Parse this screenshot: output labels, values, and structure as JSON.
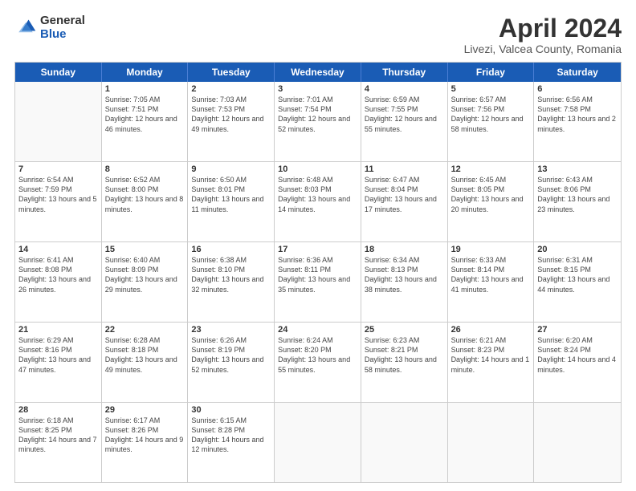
{
  "header": {
    "logo_general": "General",
    "logo_blue": "Blue",
    "title": "April 2024",
    "subtitle": "Livezi, Valcea County, Romania"
  },
  "weekdays": [
    "Sunday",
    "Monday",
    "Tuesday",
    "Wednesday",
    "Thursday",
    "Friday",
    "Saturday"
  ],
  "weeks": [
    [
      {
        "num": "",
        "sunrise": "",
        "sunset": "",
        "daylight": ""
      },
      {
        "num": "1",
        "sunrise": "Sunrise: 7:05 AM",
        "sunset": "Sunset: 7:51 PM",
        "daylight": "Daylight: 12 hours and 46 minutes."
      },
      {
        "num": "2",
        "sunrise": "Sunrise: 7:03 AM",
        "sunset": "Sunset: 7:53 PM",
        "daylight": "Daylight: 12 hours and 49 minutes."
      },
      {
        "num": "3",
        "sunrise": "Sunrise: 7:01 AM",
        "sunset": "Sunset: 7:54 PM",
        "daylight": "Daylight: 12 hours and 52 minutes."
      },
      {
        "num": "4",
        "sunrise": "Sunrise: 6:59 AM",
        "sunset": "Sunset: 7:55 PM",
        "daylight": "Daylight: 12 hours and 55 minutes."
      },
      {
        "num": "5",
        "sunrise": "Sunrise: 6:57 AM",
        "sunset": "Sunset: 7:56 PM",
        "daylight": "Daylight: 12 hours and 58 minutes."
      },
      {
        "num": "6",
        "sunrise": "Sunrise: 6:56 AM",
        "sunset": "Sunset: 7:58 PM",
        "daylight": "Daylight: 13 hours and 2 minutes."
      }
    ],
    [
      {
        "num": "7",
        "sunrise": "Sunrise: 6:54 AM",
        "sunset": "Sunset: 7:59 PM",
        "daylight": "Daylight: 13 hours and 5 minutes."
      },
      {
        "num": "8",
        "sunrise": "Sunrise: 6:52 AM",
        "sunset": "Sunset: 8:00 PM",
        "daylight": "Daylight: 13 hours and 8 minutes."
      },
      {
        "num": "9",
        "sunrise": "Sunrise: 6:50 AM",
        "sunset": "Sunset: 8:01 PM",
        "daylight": "Daylight: 13 hours and 11 minutes."
      },
      {
        "num": "10",
        "sunrise": "Sunrise: 6:48 AM",
        "sunset": "Sunset: 8:03 PM",
        "daylight": "Daylight: 13 hours and 14 minutes."
      },
      {
        "num": "11",
        "sunrise": "Sunrise: 6:47 AM",
        "sunset": "Sunset: 8:04 PM",
        "daylight": "Daylight: 13 hours and 17 minutes."
      },
      {
        "num": "12",
        "sunrise": "Sunrise: 6:45 AM",
        "sunset": "Sunset: 8:05 PM",
        "daylight": "Daylight: 13 hours and 20 minutes."
      },
      {
        "num": "13",
        "sunrise": "Sunrise: 6:43 AM",
        "sunset": "Sunset: 8:06 PM",
        "daylight": "Daylight: 13 hours and 23 minutes."
      }
    ],
    [
      {
        "num": "14",
        "sunrise": "Sunrise: 6:41 AM",
        "sunset": "Sunset: 8:08 PM",
        "daylight": "Daylight: 13 hours and 26 minutes."
      },
      {
        "num": "15",
        "sunrise": "Sunrise: 6:40 AM",
        "sunset": "Sunset: 8:09 PM",
        "daylight": "Daylight: 13 hours and 29 minutes."
      },
      {
        "num": "16",
        "sunrise": "Sunrise: 6:38 AM",
        "sunset": "Sunset: 8:10 PM",
        "daylight": "Daylight: 13 hours and 32 minutes."
      },
      {
        "num": "17",
        "sunrise": "Sunrise: 6:36 AM",
        "sunset": "Sunset: 8:11 PM",
        "daylight": "Daylight: 13 hours and 35 minutes."
      },
      {
        "num": "18",
        "sunrise": "Sunrise: 6:34 AM",
        "sunset": "Sunset: 8:13 PM",
        "daylight": "Daylight: 13 hours and 38 minutes."
      },
      {
        "num": "19",
        "sunrise": "Sunrise: 6:33 AM",
        "sunset": "Sunset: 8:14 PM",
        "daylight": "Daylight: 13 hours and 41 minutes."
      },
      {
        "num": "20",
        "sunrise": "Sunrise: 6:31 AM",
        "sunset": "Sunset: 8:15 PM",
        "daylight": "Daylight: 13 hours and 44 minutes."
      }
    ],
    [
      {
        "num": "21",
        "sunrise": "Sunrise: 6:29 AM",
        "sunset": "Sunset: 8:16 PM",
        "daylight": "Daylight: 13 hours and 47 minutes."
      },
      {
        "num": "22",
        "sunrise": "Sunrise: 6:28 AM",
        "sunset": "Sunset: 8:18 PM",
        "daylight": "Daylight: 13 hours and 49 minutes."
      },
      {
        "num": "23",
        "sunrise": "Sunrise: 6:26 AM",
        "sunset": "Sunset: 8:19 PM",
        "daylight": "Daylight: 13 hours and 52 minutes."
      },
      {
        "num": "24",
        "sunrise": "Sunrise: 6:24 AM",
        "sunset": "Sunset: 8:20 PM",
        "daylight": "Daylight: 13 hours and 55 minutes."
      },
      {
        "num": "25",
        "sunrise": "Sunrise: 6:23 AM",
        "sunset": "Sunset: 8:21 PM",
        "daylight": "Daylight: 13 hours and 58 minutes."
      },
      {
        "num": "26",
        "sunrise": "Sunrise: 6:21 AM",
        "sunset": "Sunset: 8:23 PM",
        "daylight": "Daylight: 14 hours and 1 minute."
      },
      {
        "num": "27",
        "sunrise": "Sunrise: 6:20 AM",
        "sunset": "Sunset: 8:24 PM",
        "daylight": "Daylight: 14 hours and 4 minutes."
      }
    ],
    [
      {
        "num": "28",
        "sunrise": "Sunrise: 6:18 AM",
        "sunset": "Sunset: 8:25 PM",
        "daylight": "Daylight: 14 hours and 7 minutes."
      },
      {
        "num": "29",
        "sunrise": "Sunrise: 6:17 AM",
        "sunset": "Sunset: 8:26 PM",
        "daylight": "Daylight: 14 hours and 9 minutes."
      },
      {
        "num": "30",
        "sunrise": "Sunrise: 6:15 AM",
        "sunset": "Sunset: 8:28 PM",
        "daylight": "Daylight: 14 hours and 12 minutes."
      },
      {
        "num": "",
        "sunrise": "",
        "sunset": "",
        "daylight": ""
      },
      {
        "num": "",
        "sunrise": "",
        "sunset": "",
        "daylight": ""
      },
      {
        "num": "",
        "sunrise": "",
        "sunset": "",
        "daylight": ""
      },
      {
        "num": "",
        "sunrise": "",
        "sunset": "",
        "daylight": ""
      }
    ]
  ]
}
